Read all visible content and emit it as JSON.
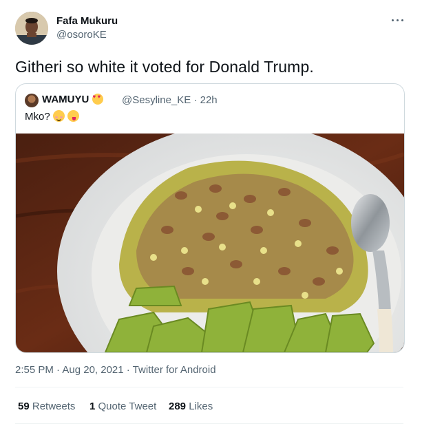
{
  "author": {
    "name": "Fafa Mukuru",
    "handle": "@osoroKE"
  },
  "tweet": {
    "text": "Githeri so white it voted for Donald Trump."
  },
  "quoted": {
    "name": "WAMUYU",
    "handle": "@Sesyline_KE",
    "separator": " · ",
    "time": "22h",
    "text": "Mko?"
  },
  "meta": {
    "timestamp": "2:55 PM · Aug 20, 2021 · Twitter for Android"
  },
  "stats": {
    "retweets_count": "59",
    "retweets_label": "Retweets",
    "quotes_count": "1",
    "quotes_label": "Quote Tweet",
    "likes_count": "289",
    "likes_label": "Likes"
  },
  "icons": {
    "more": "more-horizontal-icon",
    "name_emoji": "smiling-face-with-heart-eyes",
    "text_emojis": [
      "smiling-face-with-smiling-eyes",
      "face-savoring-food"
    ]
  },
  "colors": {
    "text": "#0f1419",
    "secondary": "#536471",
    "border": "#cfd9de"
  }
}
